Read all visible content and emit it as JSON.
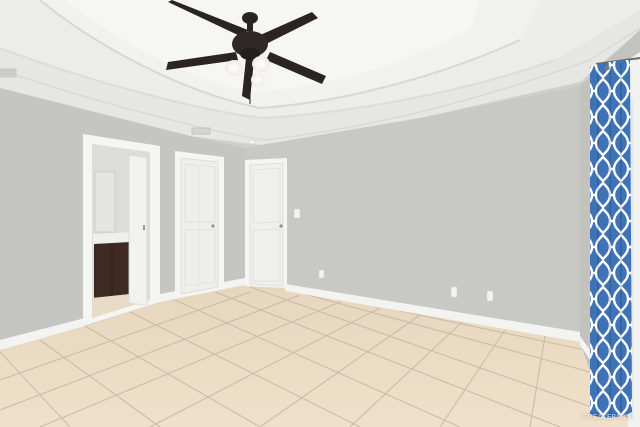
{
  "photo": {
    "watermark": "GREATERMLS"
  },
  "colors": {
    "wall_left": "#c6c6c3",
    "wall_back": "#c9c9c6",
    "ceiling": "#e7e7e4",
    "floor_tile": "#eddcc4",
    "grout": "#c9b9a2",
    "trim": "#f4f4f2",
    "door": "#f1f1ef",
    "vanity": "#3e2a22",
    "curtain_blue": "#3f73b8",
    "fan_blade": "#2a2422"
  },
  "icons": [
    "ceiling-fan-icon",
    "light-bulb-icon",
    "curtain-pattern-icon"
  ]
}
